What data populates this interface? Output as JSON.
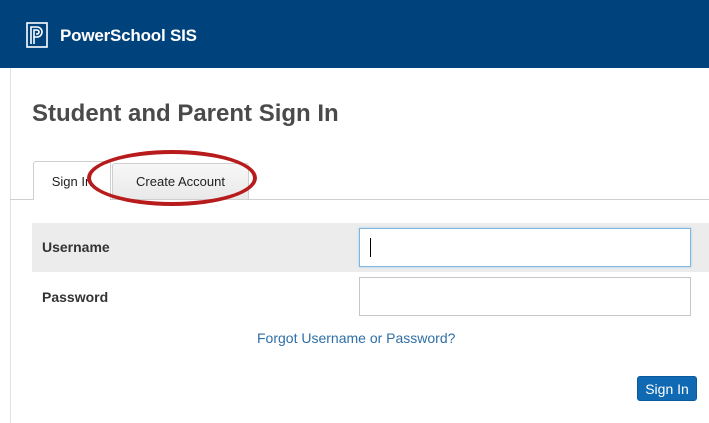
{
  "header": {
    "brand": "PowerSchool SIS",
    "logo_icon": "powerschool-logo-icon",
    "background_color": "#00427c"
  },
  "page": {
    "title": "Student and Parent Sign In"
  },
  "tabs": [
    {
      "label": "Sign In",
      "active": true
    },
    {
      "label": "Create Account",
      "active": false,
      "highlighted": true
    }
  ],
  "form": {
    "username_label": "Username",
    "username_value": "",
    "password_label": "Password",
    "password_value": "",
    "forgot_link": "Forgot Username or Password?",
    "submit_label": "Sign In"
  },
  "colors": {
    "accent": "#1069b3",
    "link": "#2f6fa7",
    "annotation": "#b81b1b"
  }
}
